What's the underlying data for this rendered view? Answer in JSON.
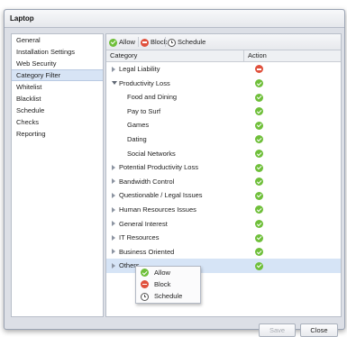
{
  "window": {
    "title": "Laptop"
  },
  "sidebar": {
    "items": [
      {
        "label": "General",
        "active": false
      },
      {
        "label": "Installation Settings",
        "active": false
      },
      {
        "label": "Web Security",
        "active": false
      },
      {
        "label": "Category Filter",
        "active": true
      },
      {
        "label": "Whitelist",
        "active": false
      },
      {
        "label": "Blacklist",
        "active": false
      },
      {
        "label": "Schedule",
        "active": false
      },
      {
        "label": "Checks",
        "active": false
      },
      {
        "label": "Reporting",
        "active": false
      }
    ]
  },
  "toolbar": {
    "allow_label": "Allow",
    "block_label": "Block",
    "schedule_label": "Schedule"
  },
  "table": {
    "columns": [
      "Category",
      "Action"
    ],
    "rows": [
      {
        "label": "Legal Liability",
        "level": 0,
        "expander": "collapsed",
        "action": "block"
      },
      {
        "label": "Productivity Loss",
        "level": 0,
        "expander": "expanded",
        "action": "allow"
      },
      {
        "label": "Food and Dining",
        "level": 1,
        "expander": "none",
        "action": "allow"
      },
      {
        "label": "Pay to Surf",
        "level": 1,
        "expander": "none",
        "action": "allow"
      },
      {
        "label": "Games",
        "level": 1,
        "expander": "none",
        "action": "allow"
      },
      {
        "label": "Dating",
        "level": 1,
        "expander": "none",
        "action": "allow"
      },
      {
        "label": "Social Networks",
        "level": 1,
        "expander": "none",
        "action": "allow"
      },
      {
        "label": "Potential Productivity Loss",
        "level": 0,
        "expander": "collapsed",
        "action": "allow"
      },
      {
        "label": "Bandwidth Control",
        "level": 0,
        "expander": "collapsed",
        "action": "allow"
      },
      {
        "label": "Questionable / Legal Issues",
        "level": 0,
        "expander": "collapsed",
        "action": "allow"
      },
      {
        "label": "Human Resources Issues",
        "level": 0,
        "expander": "collapsed",
        "action": "allow"
      },
      {
        "label": "General Interest",
        "level": 0,
        "expander": "collapsed",
        "action": "allow"
      },
      {
        "label": "IT Resources",
        "level": 0,
        "expander": "collapsed",
        "action": "allow"
      },
      {
        "label": "Business Oriented",
        "level": 0,
        "expander": "collapsed",
        "action": "allow"
      },
      {
        "label": "Others",
        "level": 0,
        "expander": "collapsed",
        "action": "allow",
        "selected": true
      }
    ]
  },
  "context_menu": {
    "items": [
      {
        "label": "Allow",
        "icon": "allow-icon"
      },
      {
        "label": "Block",
        "icon": "block-icon"
      },
      {
        "label": "Schedule",
        "icon": "clock-icon"
      }
    ]
  },
  "footer": {
    "save_label": "Save",
    "close_label": "Close"
  },
  "colors": {
    "allow": "#6fbf3a",
    "block": "#e0513d",
    "selected_row": "#d6e4f6"
  }
}
